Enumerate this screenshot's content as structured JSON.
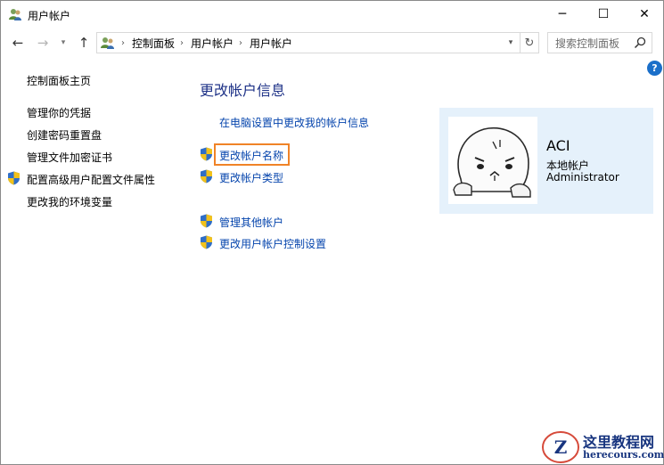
{
  "window": {
    "title": "用户帐户",
    "controls": {
      "minimize": "─",
      "maximize": "☐",
      "close": "✕"
    }
  },
  "nav": {
    "back_icon": "arrow-left-icon",
    "forward_icon": "arrow-right-icon",
    "history_icon": "chevron-down-icon",
    "up_icon": "arrow-up-icon",
    "breadcrumbs": [
      "控制面板",
      "用户帐户",
      "用户帐户"
    ],
    "search_placeholder": "搜索控制面板"
  },
  "sidebar": {
    "home": "控制面板主页",
    "items": [
      {
        "label": "管理你的凭据",
        "shield": false
      },
      {
        "label": "创建密码重置盘",
        "shield": false
      },
      {
        "label": "管理文件加密证书",
        "shield": false
      },
      {
        "label": "配置高级用户配置文件属性",
        "shield": true
      },
      {
        "label": "更改我的环境变量",
        "shield": false
      }
    ]
  },
  "main": {
    "heading": "更改帐户信息",
    "tasks": [
      {
        "label": "在电脑设置中更改我的帐户信息",
        "shield": false
      },
      {
        "label": "更改帐户名称",
        "shield": true,
        "highlighted": true
      },
      {
        "label": "更改帐户类型",
        "shield": true
      },
      {
        "label": "管理其他帐户",
        "shield": true
      },
      {
        "label": "更改用户帐户控制设置",
        "shield": true
      }
    ]
  },
  "account": {
    "name": "ACI",
    "type": "本地帐户",
    "role": "Administrator"
  },
  "help_label": "?",
  "watermark": {
    "title": "这里教程网",
    "url": "herecours.com",
    "logo_letter": "Z"
  },
  "colors": {
    "link": "#0645ad",
    "heading": "#1e3287",
    "highlight_border": "#f08327",
    "card_bg": "#e5f1fb",
    "help_bg": "#1a6fc9"
  }
}
